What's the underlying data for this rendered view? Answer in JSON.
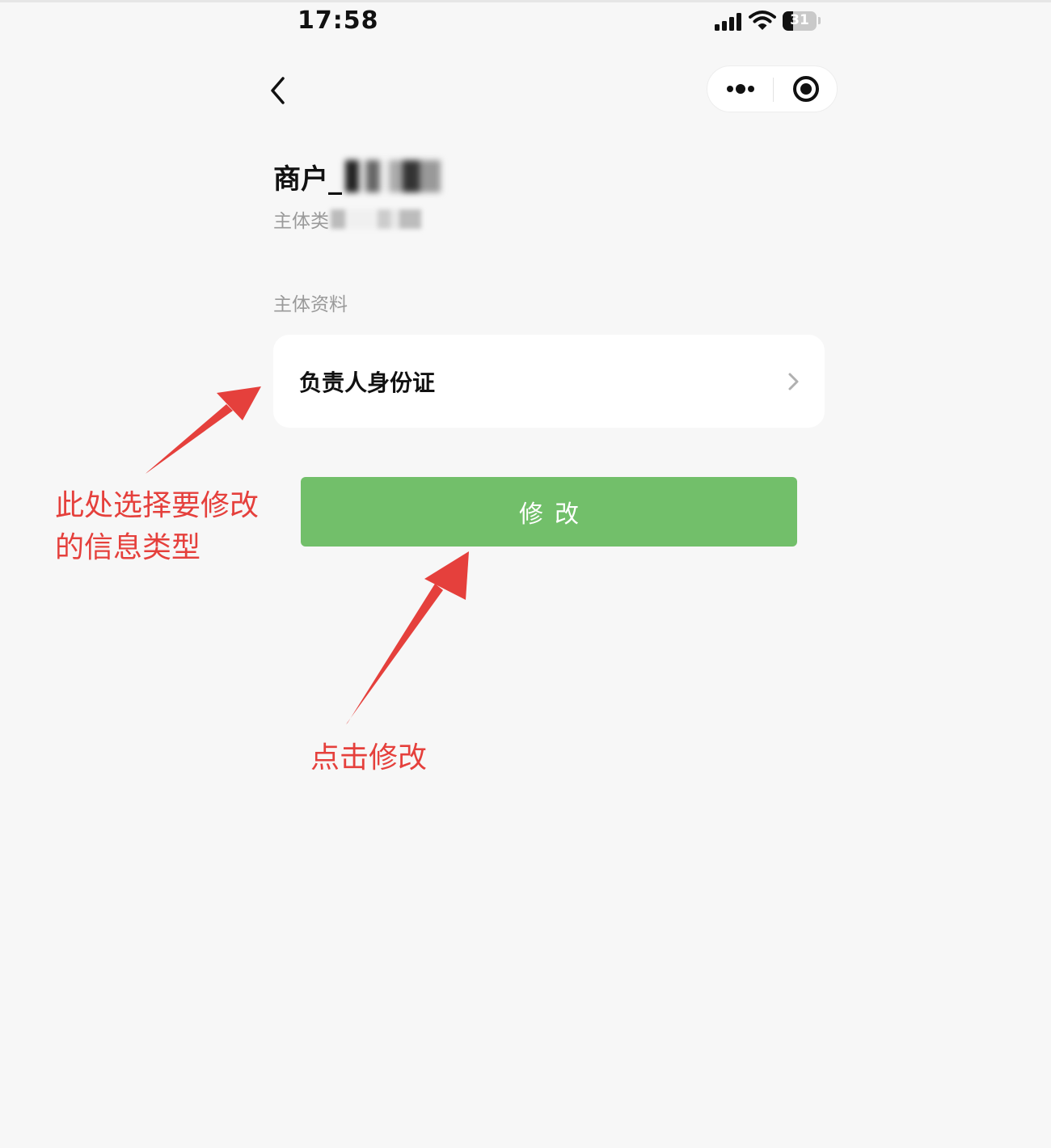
{
  "status_bar": {
    "time": "17:58",
    "battery": "31"
  },
  "header": {
    "title": "商户_",
    "subtitle": "主体类"
  },
  "section": {
    "label": "主体资料"
  },
  "card": {
    "label": "负责人身份证"
  },
  "actions": {
    "modify_label": "修改"
  },
  "annotations": {
    "choose_type_line1": "此处选择要修改",
    "choose_type_line2": "的信息类型",
    "click_modify": "点击修改"
  },
  "colors": {
    "button": "#72bf6a",
    "annotation": "#e5403c",
    "background": "#f7f7f7"
  },
  "icons": [
    "back-icon",
    "more-icon",
    "close-miniprogram-icon",
    "chevron-right-icon",
    "signal-icon",
    "wifi-icon",
    "battery-icon"
  ]
}
